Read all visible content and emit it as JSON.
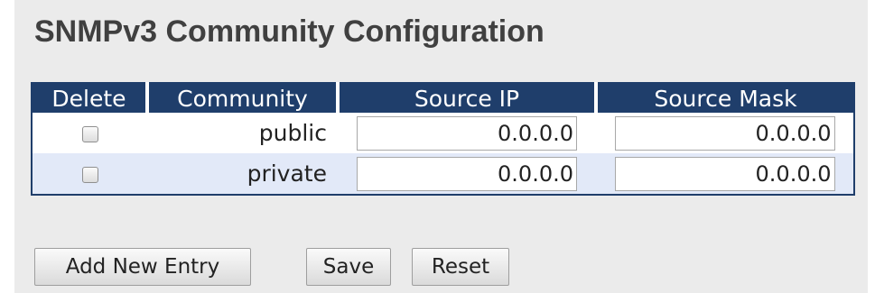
{
  "page": {
    "title": "SNMPv3 Community Configuration"
  },
  "table": {
    "columns": [
      "Delete",
      "Community",
      "Source IP",
      "Source Mask"
    ],
    "rows": [
      {
        "delete_checked": false,
        "community": "public",
        "source_ip": "0.0.0.0",
        "source_mask": "0.0.0.0"
      },
      {
        "delete_checked": false,
        "community": "private",
        "source_ip": "0.0.0.0",
        "source_mask": "0.0.0.0"
      }
    ]
  },
  "buttons": {
    "add_new_entry": "Add New Entry",
    "save": "Save",
    "reset": "Reset"
  },
  "colors": {
    "header_background": "#1f3e6b",
    "header_text": "#ffffff",
    "alternate_row": "#e2e9f8",
    "panel_background": "#ebebeb"
  }
}
